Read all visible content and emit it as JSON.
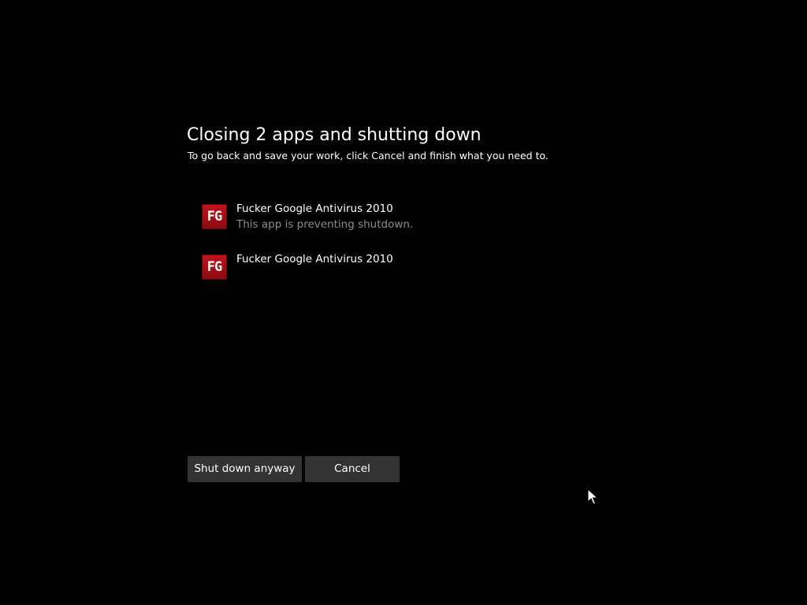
{
  "dialog": {
    "title": "Closing 2 apps and shutting down",
    "subtitle": "To go back and save your work, click Cancel and finish what you need to."
  },
  "apps": [
    {
      "icon_text": "FG",
      "icon": "app-fg-icon",
      "name": "Fucker Google Antivirus 2010",
      "status": "This app is preventing shutdown."
    },
    {
      "icon_text": "FG",
      "icon": "app-fg-icon",
      "name": "Fucker Google Antivirus 2010",
      "status": ""
    }
  ],
  "buttons": {
    "shutdown_label": "Shut down anyway",
    "cancel_label": "Cancel"
  },
  "colors": {
    "background": "#000000",
    "button": "#333333",
    "icon": "#c0141b",
    "status_text": "#8c8c8c"
  }
}
